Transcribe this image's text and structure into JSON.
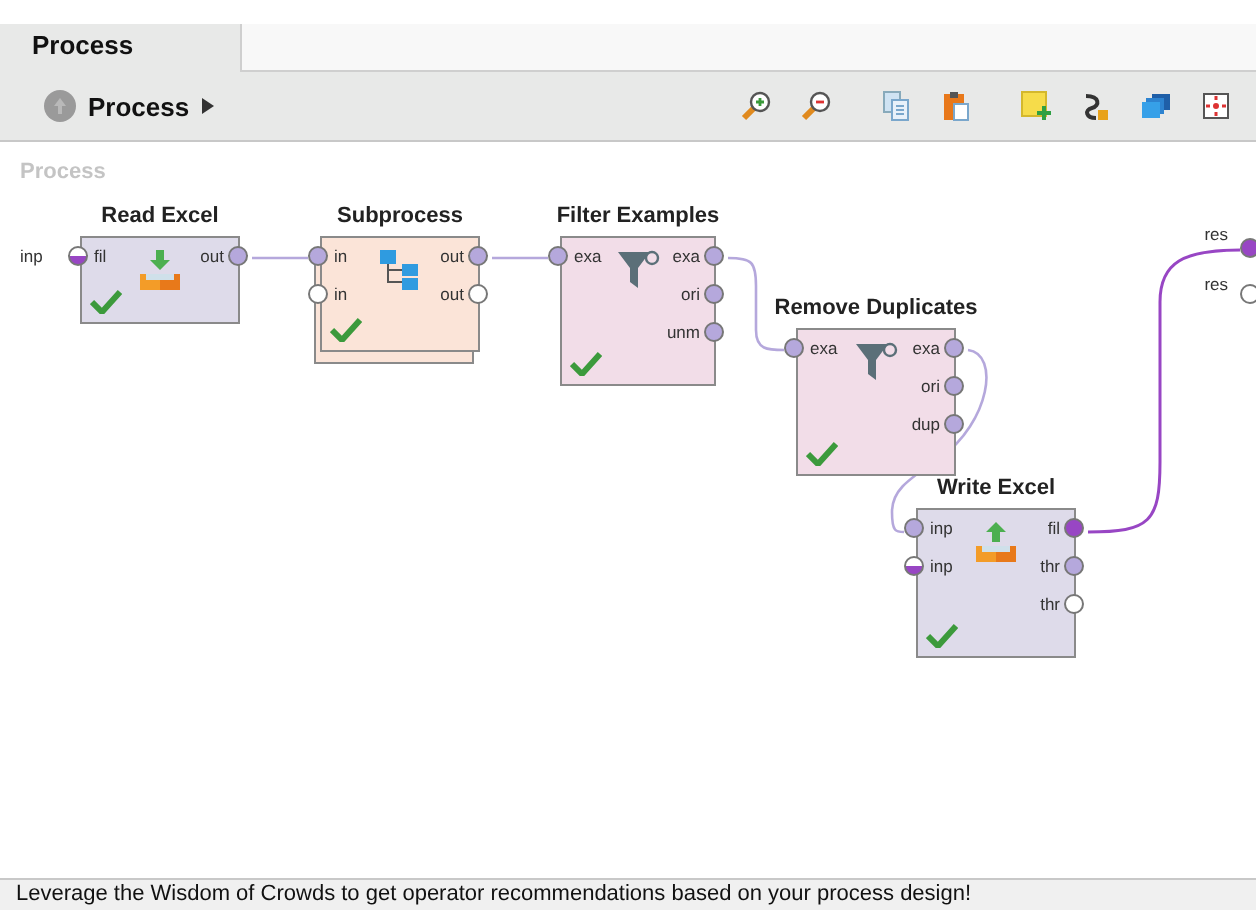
{
  "tabs": [
    {
      "label": "Process",
      "selected": true
    }
  ],
  "breadcrumb": {
    "label": "Process"
  },
  "canvas_title": "Process",
  "process_inputs": [
    {
      "label": "inp"
    }
  ],
  "process_outputs": [
    {
      "label": "res",
      "kind": "full",
      "color": "#9846c4"
    },
    {
      "label": "res",
      "kind": "open"
    }
  ],
  "operators": [
    {
      "title": "Read Excel",
      "kind": "read",
      "ok": true,
      "inputs": [
        {
          "label": "fil",
          "kind": "half",
          "color": "#9846c4"
        }
      ],
      "outputs": [
        {
          "label": "out",
          "kind": "full",
          "color": "#b5a8dc"
        }
      ]
    },
    {
      "title": "Subprocess",
      "kind": "subprocess",
      "ok": true,
      "inputs": [
        {
          "label": "in",
          "kind": "full",
          "color": "#b5a8dc"
        },
        {
          "label": "in",
          "kind": "open"
        }
      ],
      "outputs": [
        {
          "label": "out",
          "kind": "full",
          "color": "#b5a8dc"
        },
        {
          "label": "out",
          "kind": "open"
        }
      ]
    },
    {
      "title": "Filter Examples",
      "kind": "filter",
      "ok": true,
      "inputs": [
        {
          "label": "exa",
          "kind": "full",
          "color": "#b5a8dc"
        }
      ],
      "outputs": [
        {
          "label": "exa",
          "kind": "full",
          "color": "#b5a8dc"
        },
        {
          "label": "ori",
          "kind": "full",
          "color": "#b5a8dc"
        },
        {
          "label": "unm",
          "kind": "full",
          "color": "#b5a8dc"
        }
      ]
    },
    {
      "title": "Remove Duplicates",
      "kind": "filter",
      "ok": true,
      "inputs": [
        {
          "label": "exa",
          "kind": "full",
          "color": "#b5a8dc"
        }
      ],
      "outputs": [
        {
          "label": "exa",
          "kind": "full",
          "color": "#b5a8dc"
        },
        {
          "label": "ori",
          "kind": "full",
          "color": "#b5a8dc"
        },
        {
          "label": "dup",
          "kind": "full",
          "color": "#b5a8dc"
        }
      ]
    },
    {
      "title": "Write Excel",
      "kind": "write",
      "ok": true,
      "inputs": [
        {
          "label": "inp",
          "kind": "full",
          "color": "#b5a8dc"
        },
        {
          "label": "inp",
          "kind": "half",
          "color": "#9846c4"
        }
      ],
      "outputs": [
        {
          "label": "fil",
          "kind": "full",
          "color": "#9846c4"
        },
        {
          "label": "thr",
          "kind": "full",
          "color": "#b5a8dc"
        },
        {
          "label": "thr",
          "kind": "open"
        }
      ]
    }
  ],
  "status_bar": "Leverage the Wisdom of Crowds to get operator recommendations based on your process design!"
}
